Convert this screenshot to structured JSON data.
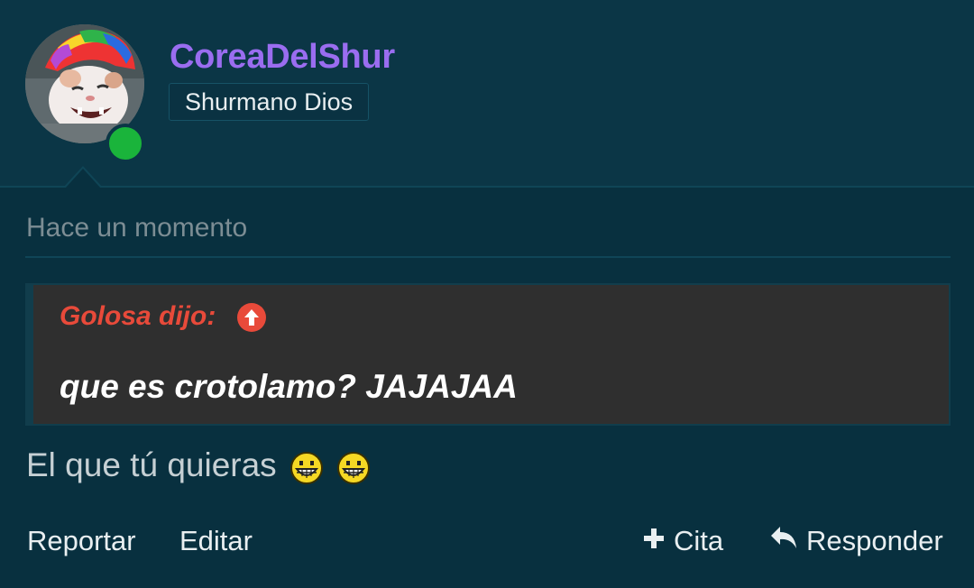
{
  "user": {
    "name": "CoreaDelShur",
    "title": "Shurmano Dios",
    "online": true,
    "avatar_icon": "cat-with-rainbow-hat-avatar"
  },
  "post": {
    "timestamp": "Hace un momento",
    "quote": {
      "author_label": "Golosa dijo:",
      "text": "que es crotolamo? JAJAJAA",
      "jump_icon": "arrow-up-circle-icon"
    },
    "message": "El que tú quieras",
    "emojis": [
      "grinning-smiley-icon",
      "grinning-smiley-icon"
    ]
  },
  "actions": {
    "report": "Reportar",
    "edit": "Editar",
    "quote": "Cita",
    "reply": "Responder"
  },
  "colors": {
    "background": "#08303f",
    "header": "#0b3646",
    "username": "#9a6df0",
    "quote_author": "#e84a3a",
    "online": "#1ab43b",
    "quote_bg": "#2f2f2f"
  }
}
